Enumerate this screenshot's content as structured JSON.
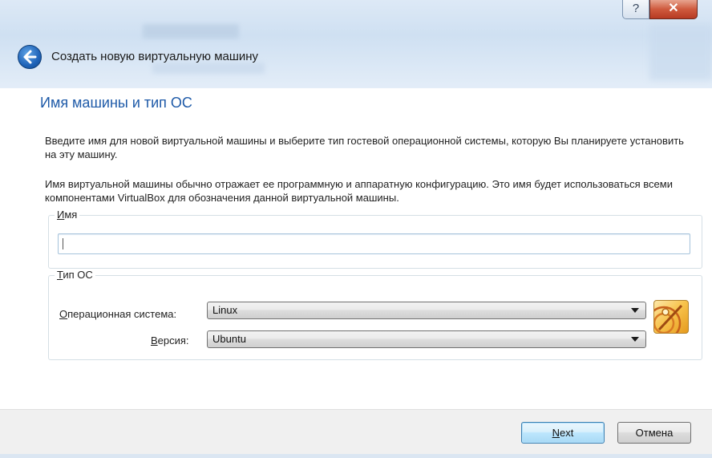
{
  "window": {
    "help_glyph": "?",
    "close_glyph": "✕"
  },
  "header": {
    "title": "Создать новую виртуальную машину"
  },
  "page": {
    "heading": "Имя машины и тип ОС",
    "description_1": "Введите имя для новой виртуальной машины и выберите тип гостевой операционной системы, которую Вы планируете установить на эту машину.",
    "description_2": "Имя виртуальной машины обычно отражает ее программную и аппаратную конфигурацию. Это имя будет использоваться всеми компонентами VirtualBox для обозначения данной виртуальной машины."
  },
  "name_group": {
    "legend_mnemonic": "И",
    "legend_rest": "мя",
    "input_value": ""
  },
  "os_group": {
    "legend_mnemonic": "Т",
    "legend_rest": "ип ОС",
    "os_label_mnemonic": "О",
    "os_label_rest": "перационная система:",
    "os_value": "Linux",
    "version_label_mnemonic": "В",
    "version_label_rest": "ерсия:",
    "version_value": "Ubuntu",
    "os_icon": "linux-os-icon"
  },
  "footer": {
    "next_mnemonic": "N",
    "next_rest": "ext",
    "cancel_label": "Отмена"
  },
  "colors": {
    "heading": "#1e5aa8",
    "close_button": "#c94a30",
    "next_border": "#3c7fb1"
  }
}
